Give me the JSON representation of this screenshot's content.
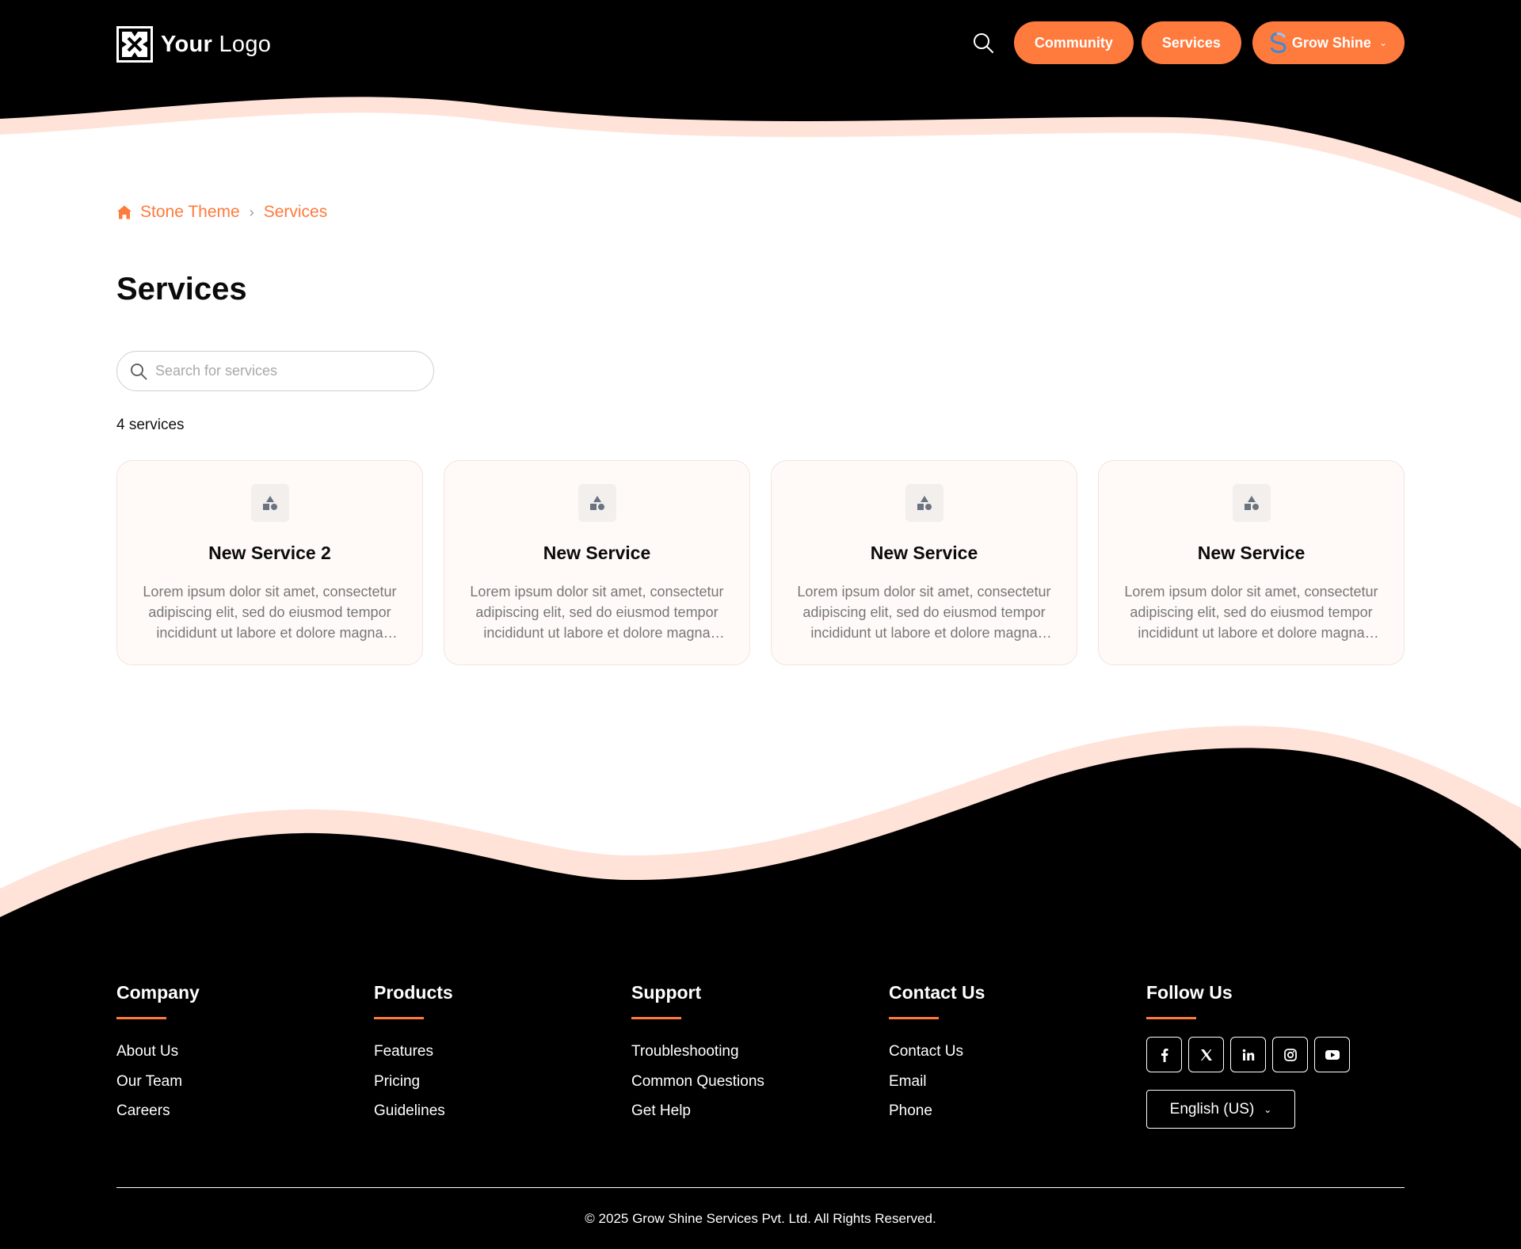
{
  "header": {
    "logo_word1": "Your",
    "logo_word2": "Logo",
    "nav": {
      "community_label": "Community",
      "services_label": "Services",
      "user_label": "Grow Shine"
    }
  },
  "breadcrumb": {
    "home_label": "Stone Theme",
    "current_label": "Services"
  },
  "page": {
    "title": "Services",
    "search_placeholder": "Search for services",
    "count_text": "4 services"
  },
  "cards": [
    {
      "title": "New Service 2",
      "description": "Lorem ipsum dolor sit amet, consectetur adipiscing elit, sed do eiusmod tempor incididunt ut labore et dolore magna aliqua."
    },
    {
      "title": "New Service",
      "description": "Lorem ipsum dolor sit amet, consectetur adipiscing elit, sed do eiusmod tempor incididunt ut labore et dolore magna aliqua."
    },
    {
      "title": "New Service",
      "description": "Lorem ipsum dolor sit amet, consectetur adipiscing elit, sed do eiusmod tempor incididunt ut labore et dolore magna aliqua."
    },
    {
      "title": "New Service",
      "description": "Lorem ipsum dolor sit amet, consectetur adipiscing elit, sed do eiusmod tempor incididunt ut labore et dolore magna aliqua."
    }
  ],
  "footer": {
    "company": {
      "heading": "Company",
      "links": [
        "About Us",
        "Our Team",
        "Careers"
      ]
    },
    "products": {
      "heading": "Products",
      "links": [
        "Features",
        "Pricing",
        "Guidelines"
      ]
    },
    "support": {
      "heading": "Support",
      "links": [
        "Troubleshooting",
        "Common Questions",
        "Get Help"
      ]
    },
    "contact": {
      "heading": "Contact Us",
      "links": [
        "Contact Us",
        "Email",
        "Phone"
      ]
    },
    "follow": {
      "heading": "Follow Us"
    },
    "social_icons": [
      "facebook-icon",
      "x-icon",
      "linkedin-icon",
      "instagram-icon",
      "youtube-icon"
    ],
    "language_label": "English (US)",
    "copyright": "© 2025 Grow Shine Services Pvt. Ltd. All Rights Reserved."
  },
  "colors": {
    "accent": "#ff7a3d",
    "dark": "#000000",
    "wave_tint": "#ffe3d9",
    "card_bg": "#fffaf7"
  }
}
